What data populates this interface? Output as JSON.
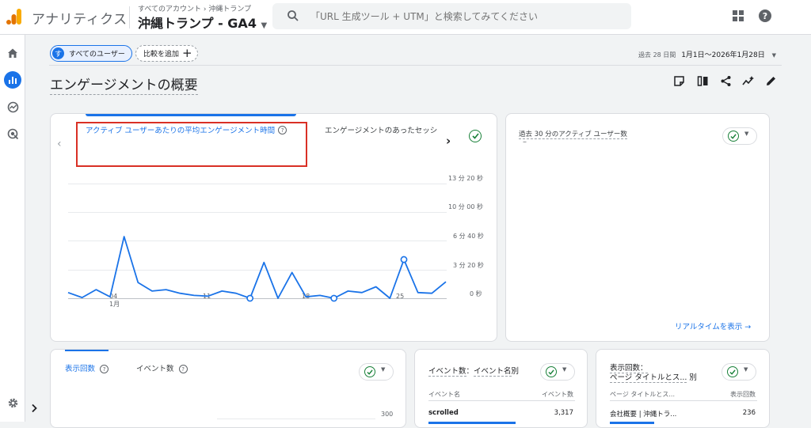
{
  "header": {
    "app_title": "アナリティクス",
    "breadcrumb_account": "すべてのアカウント",
    "breadcrumb_sep": "›",
    "breadcrumb_property": "沖縄トランプ",
    "account_name": "沖縄トランプ - GA4",
    "search_placeholder": "「URL 生成ツール + UTM」と検索してみてください"
  },
  "sidebar": {
    "items": [
      {
        "icon": "home-icon",
        "active": false
      },
      {
        "icon": "reports-icon",
        "active": true
      },
      {
        "icon": "explore-icon",
        "active": false
      },
      {
        "icon": "advertising-icon",
        "active": false
      }
    ],
    "settings_icon": "gear-icon"
  },
  "filters": {
    "user_chip_avatar": "す",
    "user_chip_label": "すべてのユーザー",
    "add_compare_label": "比較を追加",
    "date_prefix": "過去 28 日間",
    "date_range": "1月1日～2026年1月28日"
  },
  "page": {
    "title": "エンゲージメントの概要"
  },
  "main_card": {
    "tab_active": "アクティブ ユーザーあたりの平均エンゲージメント時間",
    "tab_inactive": "エンゲージメントのあったセッシ",
    "y_ticks": [
      "13 分 20 秒",
      "10 分 00 秒",
      "6 分 40 秒",
      "3 分 20 秒",
      "0 秒"
    ],
    "x_ticks": [
      "04",
      "11",
      "18",
      "25"
    ],
    "x_month": "1月"
  },
  "chart_data": {
    "type": "line",
    "title": "アクティブ ユーザーあたりの平均エンゲージメント時間",
    "x": [
      "1/1",
      "1/2",
      "1/3",
      "1/4",
      "1/5",
      "1/6",
      "1/7",
      "1/8",
      "1/9",
      "1/10",
      "1/11",
      "1/12",
      "1/13",
      "1/14",
      "1/15",
      "1/16",
      "1/17",
      "1/18",
      "1/19",
      "1/20",
      "1/21",
      "1/22",
      "1/23",
      "1/24",
      "1/25",
      "1/26",
      "1/27",
      "1/28"
    ],
    "values": [
      40,
      5,
      60,
      10,
      430,
      110,
      50,
      60,
      35,
      20,
      15,
      50,
      35,
      0,
      250,
      0,
      180,
      10,
      20,
      0,
      50,
      40,
      80,
      0,
      270,
      40,
      35,
      115
    ],
    "ylabel": "",
    "ylim": [
      0,
      800
    ],
    "unit": "seconds",
    "marked_points": [
      13,
      19,
      24
    ],
    "grid": true
  },
  "realtime_card": {
    "label": "過去 30 分のアクティブ ユーザー数",
    "value": "–",
    "link": "リアルタイムを表示 →"
  },
  "card_views": {
    "tab_active": "表示回数",
    "tab_inactive": "イベント数",
    "axis_value": "300"
  },
  "card_events": {
    "title_a": "イベント数",
    "title_b": "イベント名",
    "title_suffix": "別",
    "col1": "イベント名",
    "col2": "イベント数",
    "row1_name": "scrolled",
    "row1_value": "3,317"
  },
  "card_pages": {
    "title_a": "表示回数：",
    "title_b": "ページ タイトルとス...",
    "title_suffix": "別",
    "col1": "ページ タイトルとス...",
    "col2": "表示回数",
    "row1_name": "会社概要 | 沖縄トラ...",
    "row1_value": "236"
  }
}
